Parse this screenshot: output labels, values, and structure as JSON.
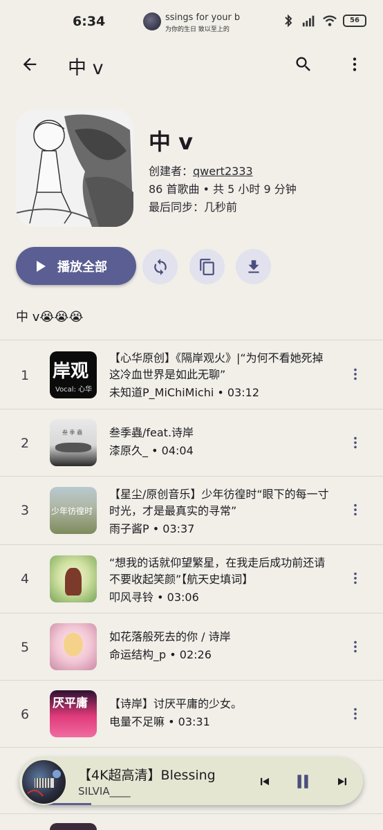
{
  "status_bar": {
    "time": "6:34",
    "media_title": "ssings for your b",
    "media_subtitle": "为你的生日 致以至上的",
    "battery": "56"
  },
  "appbar": {
    "title": "中 v",
    "back_icon": "arrow-back-icon",
    "search_icon": "search-icon",
    "more_icon": "more-vert-icon"
  },
  "playlist": {
    "name": "中 v",
    "creator_label": "创建者：",
    "creator": "qwert2333",
    "stats": "86 首歌曲 • 共 5 小时 9 分钟",
    "last_sync": "最后同步：几秒前",
    "description": "中 v😭😭😭"
  },
  "actions": {
    "play_all": "播放全部",
    "sync_icon": "sync-icon",
    "copy_icon": "copy-icon",
    "download_icon": "download-icon"
  },
  "songs": [
    {
      "index": "1",
      "title": "【心华原创】《隔岸观火》|“为何不看她死掉 这冷血世界是如此无聊”",
      "artist": "未知道P_MiChiMichi",
      "duration": "03:12",
      "thumb_text": "岸观",
      "thumb_sub": "Vocal: 心华"
    },
    {
      "index": "2",
      "title": "叁季蟲/feat.诗岸",
      "artist": "漆原久_",
      "duration": "04:04",
      "thumb_text": "叁 季 蟲"
    },
    {
      "index": "3",
      "title": "【星尘/原创音乐】少年彷徨时“眼下的每一寸时光，才是最真实的寻常”",
      "artist": "雨子酱P",
      "duration": "03:37",
      "thumb_text": "少年彷徨时"
    },
    {
      "index": "4",
      "title": "“想我的话就仰望繁星，在我走后成功前还请不要收起笑颜”【航天史填词】",
      "artist": "叩风寻铃",
      "duration": "03:06"
    },
    {
      "index": "5",
      "title": "如花落般死去的你 / 诗岸",
      "artist": "命运结构_p",
      "duration": "02:26"
    },
    {
      "index": "6",
      "title": "【诗岸】讨厌平庸的少女。",
      "artist": "电量不足嘛",
      "duration": "03:31",
      "thumb_text": "厌平庸"
    }
  ],
  "separator": "•",
  "mini_player": {
    "title": "【4K超高清】Blessing",
    "artist": "SILVIA____",
    "progress": 0.21
  },
  "colors": {
    "background": "#f1efe8",
    "accent": "#5b5e92",
    "tonal": "#e2e1ee",
    "mini_player_bg": "#e5e6d1"
  }
}
